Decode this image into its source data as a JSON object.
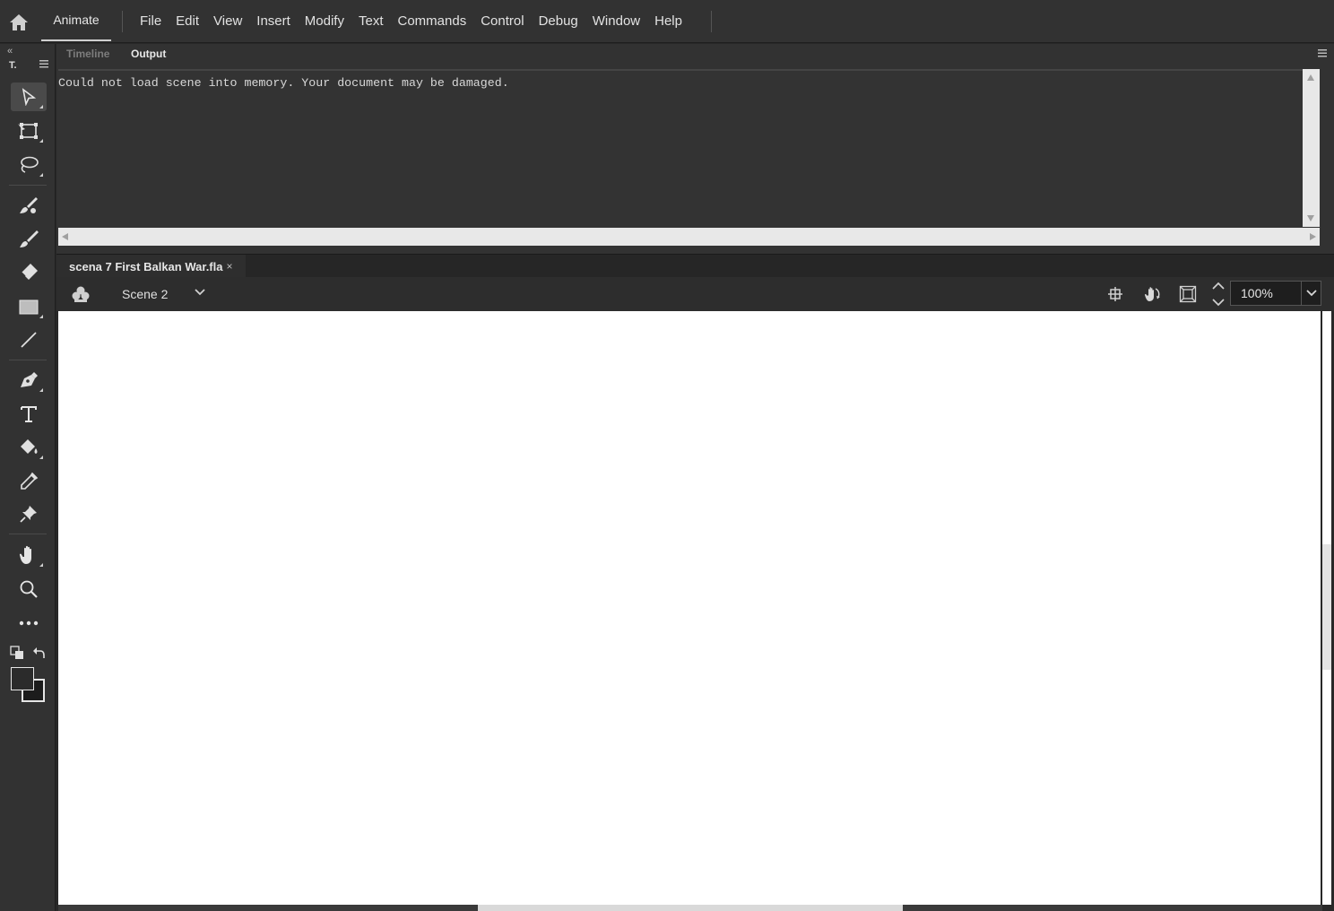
{
  "app": {
    "name": "Animate",
    "home_icon": "home-icon"
  },
  "menu": [
    "File",
    "Edit",
    "View",
    "Insert",
    "Modify",
    "Text",
    "Commands",
    "Control",
    "Debug",
    "Window",
    "Help"
  ],
  "tools_panel": {
    "collapse_glyph": "«",
    "title": "T.",
    "tools": [
      {
        "name": "selection-tool",
        "icon": "arrow-pointer-icon",
        "active": true
      },
      {
        "name": "free-transform-tool",
        "icon": "transform-icon"
      },
      {
        "name": "lasso-tool",
        "icon": "lasso-icon"
      },
      {
        "name": "paint-brush-tool",
        "icon": "paint-brush-icon"
      },
      {
        "name": "brush-tool",
        "icon": "brush-icon"
      },
      {
        "name": "eraser-tool",
        "icon": "eraser-icon"
      },
      {
        "name": "rectangle-tool",
        "icon": "rectangle-icon"
      },
      {
        "name": "line-tool",
        "icon": "line-icon"
      },
      {
        "name": "pen-tool",
        "icon": "pen-icon"
      },
      {
        "name": "text-tool",
        "icon": "text-icon"
      },
      {
        "name": "paint-bucket-tool",
        "icon": "paint-bucket-icon"
      },
      {
        "name": "eyedropper-tool",
        "icon": "eyedropper-icon"
      },
      {
        "name": "pin-tool",
        "icon": "pin-icon"
      },
      {
        "name": "hand-tool",
        "icon": "hand-icon"
      },
      {
        "name": "zoom-tool",
        "icon": "magnifier-icon"
      },
      {
        "name": "more-tools",
        "icon": "ellipsis-icon"
      }
    ],
    "stroke_color": "#1c1c1c",
    "fill_color": "#2b2b2b"
  },
  "output_panel": {
    "tabs": [
      {
        "label": "Timeline",
        "active": false
      },
      {
        "label": "Output",
        "active": true
      }
    ],
    "message": "Could not load scene into memory. Your document may be damaged."
  },
  "document": {
    "tab_title": "scena 7 First Balkan War.fla",
    "close_glyph": "×",
    "scene_label": "Scene 2",
    "zoom": "100%",
    "stage_color": "#ffffff"
  },
  "colors": {
    "bg_dark": "#282828",
    "panel": "#323232",
    "text": "#d8d8d8"
  }
}
